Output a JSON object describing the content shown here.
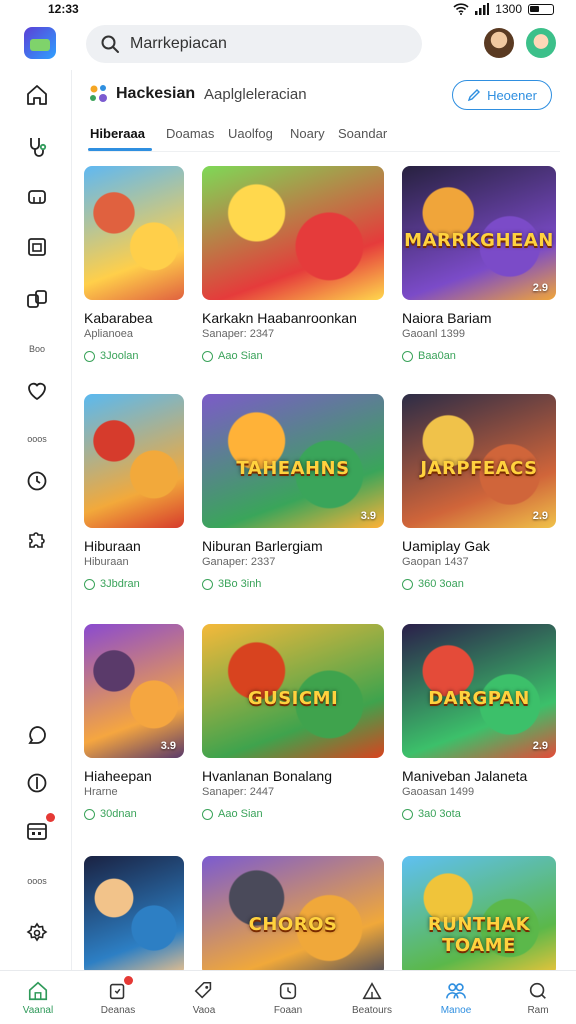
{
  "status_bar": {
    "time": "12:33",
    "signal_text": "1300"
  },
  "search": {
    "value": "Marrkepiacan",
    "placeholder": "Marrkepiacan"
  },
  "header": {
    "brand_title": "Hackesian",
    "brand_subtitle": "Aaplgleleracian",
    "action_button": "Heoener"
  },
  "tabs": [
    "Hiberaaa",
    "Doamas",
    "Uaolfog",
    "Noary",
    "Soandar"
  ],
  "sidebar": {
    "labels": [
      "Boo",
      "ooos",
      "ooos"
    ],
    "icons": [
      "home-icon",
      "stethoscope-icon",
      "cap-icon",
      "window-icon",
      "cards-icon",
      "heart-icon",
      "clock-icon",
      "puzzle-icon",
      "chat-icon",
      "info-icon",
      "calendar-icon",
      "settings-icon"
    ]
  },
  "cards": [
    {
      "title": "Kabarabea",
      "subtitle": "Aplianoea",
      "price": "3Joolan",
      "badge": "",
      "overlay": "",
      "palette": [
        "#5fb8f2",
        "#ffcf4a",
        "#e0613f"
      ]
    },
    {
      "title": "Karkakn Haabanroonkan",
      "subtitle": "Sanaper: 2347",
      "price": "Aao Sian",
      "badge": "",
      "overlay": "",
      "palette": [
        "#7ed957",
        "#e53b3b",
        "#ffd84d"
      ]
    },
    {
      "title": "Naiora Bariam",
      "subtitle": "Gaoanl 1399",
      "price": "Baa0an",
      "badge": "2.9",
      "overlay": "MARRKGHEAN",
      "palette": [
        "#27213f",
        "#7b4bc8",
        "#f0a53a"
      ]
    },
    {
      "title": "Hiburaan",
      "subtitle": "Hiburaan",
      "price": "3Jbdran",
      "badge": "",
      "overlay": "",
      "palette": [
        "#5ab9f0",
        "#f2a93b",
        "#d63b2c"
      ]
    },
    {
      "title": "Niburan Barlergiam",
      "subtitle": "Ganaper: 2337",
      "price": "3Bo 3inh",
      "badge": "3.9",
      "overlay": "TAHEAHNS",
      "palette": [
        "#7c5bc8",
        "#3aa55a",
        "#ffb238"
      ]
    },
    {
      "title": "Uamiplay Gak",
      "subtitle": "Gaopan 1437",
      "price": "360 3oan",
      "badge": "2.9",
      "overlay": "JARPFEACS",
      "palette": [
        "#2c2c46",
        "#d0653a",
        "#f0c24a"
      ]
    },
    {
      "title": "Hiaheepan",
      "subtitle": "Hrarne",
      "price": "30dnan",
      "badge": "3.9",
      "overlay": "",
      "palette": [
        "#8a4ad0",
        "#f5a640",
        "#5a3a6a"
      ]
    },
    {
      "title": "Hvanlanan Bonalang",
      "subtitle": "Sanaper: 2447",
      "price": "Aao Sian",
      "badge": "",
      "overlay": "GUSICMI",
      "palette": [
        "#f5b93a",
        "#3fa34d",
        "#d8431f"
      ]
    },
    {
      "title": "Maniveban Jalaneta",
      "subtitle": "Gaoasan 1499",
      "price": "3a0 3ota",
      "badge": "2.9",
      "overlay": "DARGPAN",
      "palette": [
        "#2a1f4a",
        "#3cc06a",
        "#e44b39"
      ]
    },
    {
      "title": "",
      "subtitle": "",
      "price": "",
      "badge": "",
      "overlay": "",
      "palette": [
        "#1a2242",
        "#2d7fc4",
        "#f2c38a"
      ]
    },
    {
      "title": "",
      "subtitle": "",
      "price": "",
      "badge": "",
      "overlay": "CHOROS",
      "palette": [
        "#7b5bd0",
        "#f0a83a",
        "#4a4a5a"
      ]
    },
    {
      "title": "",
      "subtitle": "",
      "price": "",
      "badge": "",
      "overlay": "RUNTHAK TOAME",
      "palette": [
        "#5fc0f2",
        "#5bb84a",
        "#f0c43a"
      ]
    }
  ],
  "bottom_nav": [
    {
      "label": "Vaanal",
      "icon": "home-icon"
    },
    {
      "label": "Deanas",
      "icon": "bell-icon"
    },
    {
      "label": "Vaoa",
      "icon": "tag-icon"
    },
    {
      "label": "Foaan",
      "icon": "clock-icon"
    },
    {
      "label": "Beatours",
      "icon": "tent-icon"
    },
    {
      "label": "Manoe",
      "icon": "people-icon"
    },
    {
      "label": "Ram",
      "icon": "search-icon"
    }
  ],
  "colors": {
    "accent": "#2f8fe0",
    "green": "#3aa35a",
    "notification": "#e53935"
  }
}
